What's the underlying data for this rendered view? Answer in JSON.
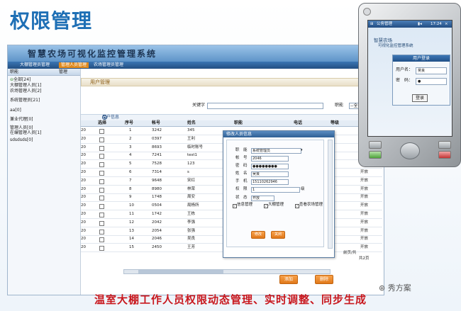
{
  "slide_title": "权限管理",
  "caption": "温室大棚工作人员权限动态管理、实时调整、同步生成",
  "watermark": "秀方案",
  "app": {
    "banner_title": "智慧农场可视化监控管理系统",
    "nav_tabs": [
      "大棚管理员管理",
      "管理人员管理",
      "农场管理员管理"
    ],
    "active_tab": 1,
    "sidebar": {
      "header": "职能",
      "header_action": "管理",
      "tree": [
        "全部[24]",
        "大棚管理人员[1]",
        "农场管理人员[2]",
        "系统管理员[21]",
        "aa[0]",
        "兼业代理[0]",
        "管理人员[0]",
        "在编管理人员[1]",
        "sdsdsds[0]"
      ]
    },
    "main": {
      "panel_title": "用户管理",
      "search": {
        "keyword_label": "关键字",
        "role_label": "职能",
        "role_value": "--全部--"
      },
      "grid_caption": "用户信息",
      "columns": [
        "选择",
        "序号",
        "帐号",
        "姓名",
        "职能",
        "电话",
        "等级",
        "状态"
      ],
      "rows": [
        [
          "1",
          "3242",
          "345",
          "",
          "",
          "",
          "开放",
          "20"
        ],
        [
          "2",
          "0397",
          "王利",
          "大",
          "",
          "",
          "开放",
          "20"
        ],
        [
          "3",
          "8693",
          "临时账号",
          "农",
          "",
          "",
          "开放",
          "20"
        ],
        [
          "4",
          "7241",
          "test1",
          "",
          "",
          "",
          "开放",
          "20"
        ],
        [
          "5",
          "7528",
          "123",
          "",
          "",
          "",
          "开放",
          "20"
        ],
        [
          "6",
          "7314",
          "s",
          "",
          "",
          "",
          "开放",
          "20"
        ],
        [
          "7",
          "9648",
          "宋红",
          "",
          "",
          "",
          "开放",
          "20"
        ],
        [
          "8",
          "8980",
          "林荣",
          "",
          "",
          "",
          "开放",
          "20"
        ],
        [
          "9",
          "1748",
          "周安",
          "",
          "",
          "",
          "开放",
          "20"
        ],
        [
          "10",
          "0504",
          "局杨所",
          "",
          "",
          "",
          "开放",
          "20"
        ],
        [
          "11",
          "1742",
          "王栋",
          "",
          "",
          "",
          "开放",
          "20"
        ],
        [
          "12",
          "2042",
          "李强",
          "",
          "",
          "",
          "开放",
          "20"
        ],
        [
          "13",
          "2054",
          "张强",
          "",
          "",
          "",
          "开放",
          "20"
        ],
        [
          "14",
          "2046",
          "吴良",
          "",
          "",
          "",
          "开放",
          "20"
        ],
        [
          "15",
          "2450",
          "王芳",
          "",
          "",
          "",
          "开放",
          "20"
        ]
      ],
      "footer_note": "前页/共",
      "footer_note2": "共2页",
      "add_button": "添加",
      "delete_button": "删除"
    },
    "modal": {
      "title": "修改人员信息",
      "fields": [
        {
          "label": "职　能",
          "value": "系统管理员"
        },
        {
          "label": "帐　号",
          "value": "2046"
        },
        {
          "label": "密　码",
          "value": "●●●●●●●●"
        },
        {
          "label": "姓　名",
          "value": "吴良"
        },
        {
          "label": "手　机",
          "value": "15110262946"
        },
        {
          "label": "权　限",
          "value": "1"
        },
        {
          "label": "状　态",
          "value": "开放"
        }
      ],
      "level_unit": "级",
      "checkboxes": [
        "信息管理",
        "大棚管理",
        "查看农场管理"
      ],
      "save_button": "修改",
      "cancel_button": "关闭"
    }
  },
  "phone": {
    "status_app": "公务管理",
    "status_time": "17:24",
    "app_title": "智慧农场",
    "app_subtitle": "可视化监控管理系统",
    "login_title": "用户登录",
    "username_label": "用户名：",
    "username_value": "吴良",
    "password_label": "密　码：",
    "password_value": "●",
    "login_button": "登录"
  }
}
